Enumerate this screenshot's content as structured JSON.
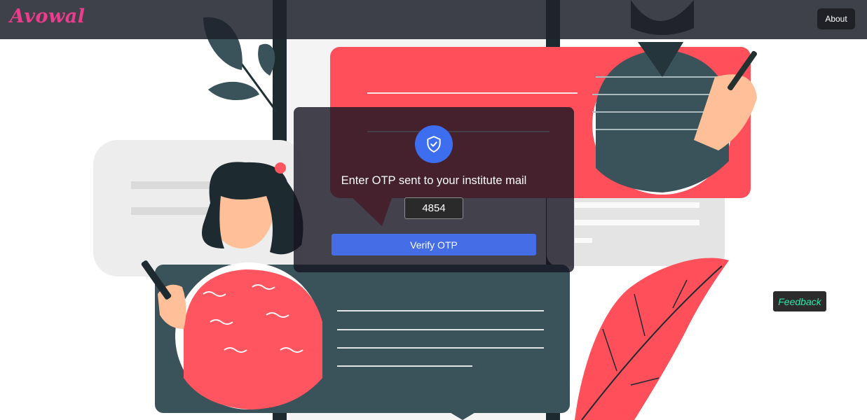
{
  "navbar": {
    "brand": "Avowal",
    "about_label": "About"
  },
  "otp_card": {
    "icon": "shield-check-icon",
    "title": "Enter OTP sent to your institute mail",
    "otp_value": "4854",
    "verify_label": "Verify OTP"
  },
  "feedback": {
    "label": "Feedback"
  },
  "colors": {
    "brand": "#ec3c8c",
    "accent_blue": "#456de6",
    "illustration_red": "#ff4f5a",
    "illustration_teal": "#3a5259",
    "feedback_text": "#2ee6a6"
  }
}
